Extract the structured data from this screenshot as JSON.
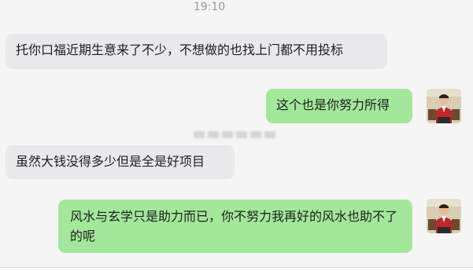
{
  "chat": {
    "timestamp": "19:10",
    "messages": [
      {
        "side": "in",
        "text": "托你口福近期生意来了不少，不想做的也找上门都不用投标"
      },
      {
        "side": "out",
        "text": "这个也是你努力所得"
      },
      {
        "side": "in",
        "text": "虽然大钱没得多少但是全是好项目"
      },
      {
        "side": "out",
        "text": "风水与玄学只是助力而已，你不努力我再好的风水也助不了的呢"
      }
    ]
  },
  "colors": {
    "background": "#f5f5f5",
    "incoming_bubble": "#e9e9eb",
    "outgoing_bubble": "#a3e89a"
  },
  "icons": {
    "avatar": "user-avatar-photo"
  }
}
